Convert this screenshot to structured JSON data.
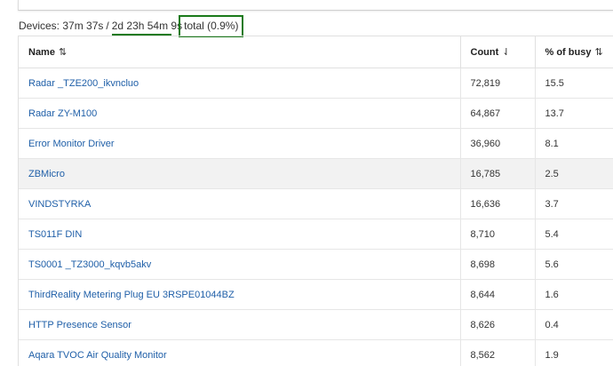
{
  "summary": {
    "prefix": "Devices: 37m 37s",
    "separator": "/",
    "uptime": "2d 23h 54m 9s",
    "total": "total (0.9%)"
  },
  "table": {
    "columns": [
      {
        "label": "Name",
        "sort_icon": "sort-icon",
        "sort_glyph": "⇅"
      },
      {
        "label": "Count",
        "sort_icon": "sort-descending-icon",
        "sort_glyph": "⇃"
      },
      {
        "label": "% of busy",
        "sort_icon": "sort-icon",
        "sort_glyph": "⇅"
      }
    ],
    "rows": [
      {
        "name": "Radar _TZE200_ikvncluo",
        "count": "72,819",
        "busy": "15.5"
      },
      {
        "name": "Radar ZY-M100",
        "count": "64,867",
        "busy": "13.7"
      },
      {
        "name": "Error Monitor Driver",
        "count": "36,960",
        "busy": "8.1"
      },
      {
        "name": "ZBMicro",
        "count": "16,785",
        "busy": "2.5"
      },
      {
        "name": "VINDSTYRKA",
        "count": "16,636",
        "busy": "3.7"
      },
      {
        "name": "TS011F DIN",
        "count": "8,710",
        "busy": "5.4"
      },
      {
        "name": "TS0001 _TZ3000_kqvb5akv",
        "count": "8,698",
        "busy": "5.6"
      },
      {
        "name": "ThirdReality Metering Plug EU 3RSPE01044BZ",
        "count": "8,644",
        "busy": "1.6"
      },
      {
        "name": "HTTP Presence Sensor",
        "count": "8,626",
        "busy": "0.4"
      },
      {
        "name": "Aqara TVOC Air Quality Monitor",
        "count": "8,562",
        "busy": "1.9"
      }
    ]
  },
  "colors": {
    "link": "#1f5fa8",
    "annotation": "#1a7a1a",
    "hover_row": "#f2f2f2"
  }
}
